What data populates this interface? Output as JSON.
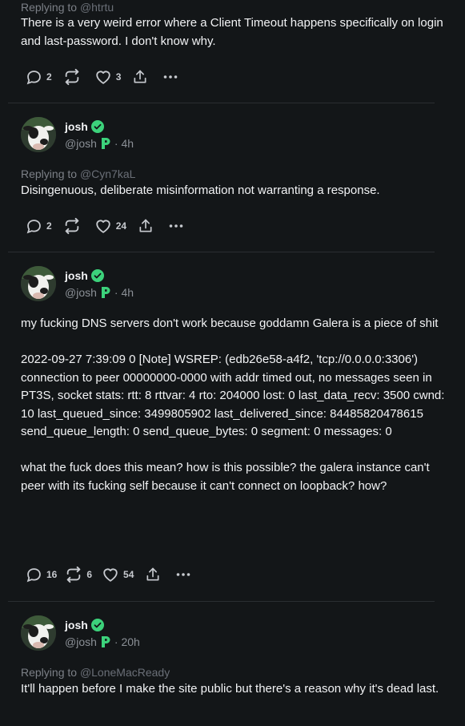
{
  "posts": [
    {
      "partial": true,
      "replying_prefix": "Replying to",
      "replying_handle": "@htrtu",
      "text": "There is a very weird error where a Client Timeout happens specifically on login and last-password. I don't know why.",
      "replies": "2",
      "reposts": "",
      "likes": "3"
    },
    {
      "name": "josh",
      "handle": "@josh",
      "time": "· 4h",
      "replying_prefix": "Replying to",
      "replying_handle": "@Cyn7kaL",
      "text": "Disingenuous, deliberate misinformation not warranting a response.",
      "replies": "2",
      "reposts": "",
      "likes": "24"
    },
    {
      "name": "josh",
      "handle": "@josh",
      "time": "· 4h",
      "text": "my fucking DNS servers don't work because goddamn Galera is a piece of shit\n\n2022-09-27 7:39:09 0 [Note] WSREP: (edb26e58-a4f2, 'tcp://0.0.0.0:3306') connection to peer 00000000-0000 with addr timed out, no messages seen in PT3S, socket stats: rtt: 8 rttvar: 4 rto: 204000 lost: 0 last_data_recv: 3500 cwnd: 10 last_queued_since: 3499805902 last_delivered_since: 84485820478615 send_queue_length: 0 send_queue_bytes: 0 segment: 0 messages: 0\n\nwhat the fuck does this mean? how is this possible? the galera instance can't peer with its fucking self because it can't connect on loopback? how?",
      "replies": "16",
      "reposts": "6",
      "likes": "54"
    },
    {
      "name": "josh",
      "handle": "@josh",
      "time": "· 20h",
      "replying_prefix": "Replying to",
      "replying_handle": "@LoneMacReady",
      "text": "It'll happen before I make the site public but there's a reason why it's dead last."
    }
  ],
  "colors": {
    "background": "#131618",
    "verified": "#3cd27b",
    "badge_p": "#3cd27b"
  }
}
